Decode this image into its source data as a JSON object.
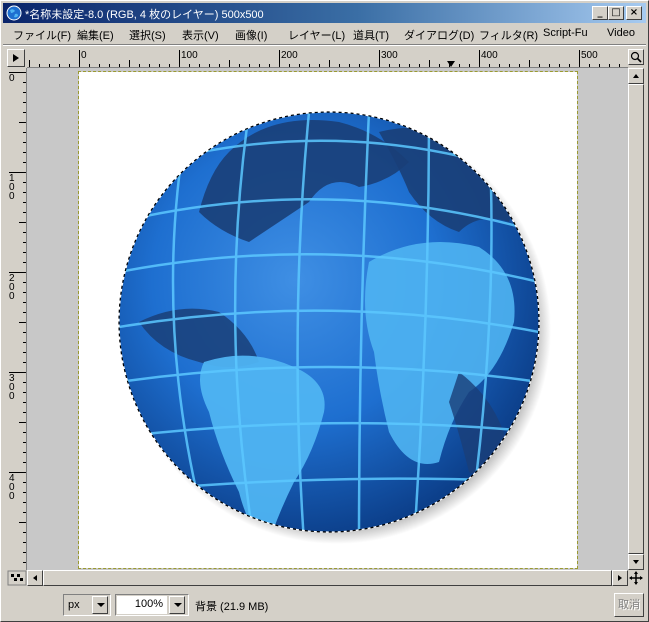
{
  "window": {
    "title": "*名称未設定-8.0 (RGB, 4 枚のレイヤー) 500x500",
    "min_label": "_",
    "max_label": "□",
    "close_label": "×"
  },
  "menu": {
    "items": [
      {
        "label": "ファイル(F)"
      },
      {
        "label": "編集(E)"
      },
      {
        "label": "選択(S)"
      },
      {
        "label": "表示(V)"
      },
      {
        "label": "画像(I)"
      },
      {
        "label": "レイヤー(L)"
      },
      {
        "label": "道具(T)"
      },
      {
        "label": "ダイアログ(D)"
      },
      {
        "label": "フィルタ(R)"
      },
      {
        "label": "Script-Fu"
      },
      {
        "label": "Video"
      }
    ]
  },
  "rulers": {
    "horizontal_labels": [
      "0",
      "100",
      "200",
      "300",
      "400",
      "500"
    ],
    "vertical_labels": [
      "0",
      "100",
      "200",
      "300",
      "400"
    ]
  },
  "statusbar": {
    "unit": "px",
    "zoom": "100%",
    "status": "背景 (21.9 MB)",
    "cancel": "取消"
  },
  "canvas": {
    "image_content": "globe",
    "ocean_color": "#1e6fd0",
    "land_dark_color": "#1a3f78",
    "land_light_color": "#4fb4f2",
    "grid_color": "#5cc8ff"
  },
  "icons": {
    "app": "gimp-globe-icon",
    "zoom": "magnifier-icon",
    "navigate": "move-cross-icon"
  }
}
